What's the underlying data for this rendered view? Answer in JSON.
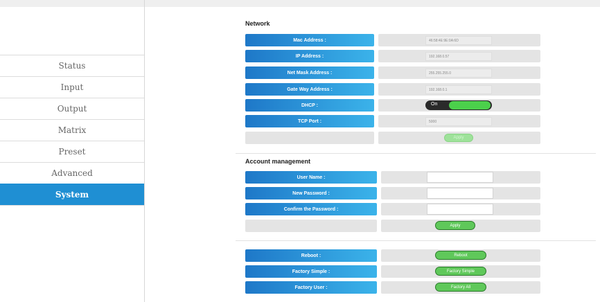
{
  "sidebar": {
    "items": [
      {
        "label": "Status"
      },
      {
        "label": "Input"
      },
      {
        "label": "Output"
      },
      {
        "label": "Matrix"
      },
      {
        "label": "Preset"
      },
      {
        "label": "Advanced"
      },
      {
        "label": "System"
      }
    ],
    "active": "System"
  },
  "network": {
    "title": "Network",
    "mac_label": "Mac Address :",
    "mac_value": "46:58:4E:9E:0A:6D",
    "ip_label": "IP Address :",
    "ip_value": "192.168.0.57",
    "mask_label": "Net Mask Address :",
    "mask_value": "255.255.255.0",
    "gateway_label": "Gate Way Address :",
    "gateway_value": "192.168.0.1",
    "dhcp_label": "DHCP :",
    "dhcp_state": "On",
    "tcp_label": "TCP Port :",
    "tcp_value": "5000",
    "apply_label": "Apply"
  },
  "account": {
    "title": "Account management",
    "username_label": "User Name :",
    "newpass_label": "New Password :",
    "confirm_label": "Confirm the Password :",
    "apply_label": "Apply"
  },
  "system_actions": {
    "reboot_label": "Reboot :",
    "reboot_button": "Reboot",
    "factory_simple_label": "Factory Simple :",
    "factory_simple_button": "Factory Simple",
    "factory_user_label": "Factory User :",
    "factory_user_button": "Factory All"
  },
  "colors": {
    "accent_blue": "#1f8fd3",
    "toggle_green": "#4bd04b",
    "button_green": "#5fc85a"
  }
}
